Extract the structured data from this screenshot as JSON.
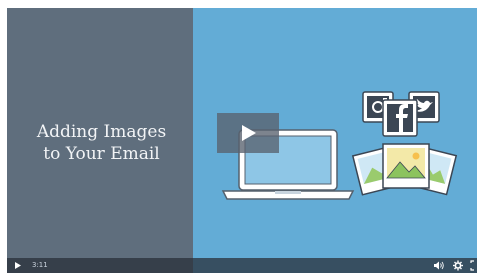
{
  "video": {
    "title_line1": "Adding Images",
    "title_line2": "to Your Email"
  },
  "controls": {
    "time": "3:11"
  },
  "icons": {
    "play": "play-icon",
    "play_small": "play-small-icon",
    "volume": "volume-icon",
    "settings": "gear-icon",
    "fullscreen": "fullscreen-icon",
    "laptop": "laptop-icon",
    "instagram": "instagram-icon",
    "facebook": "facebook-icon",
    "twitter": "twitter-icon",
    "photos": "photo-stack-icon"
  },
  "colors": {
    "left_panel": "#5f6e7d",
    "right_panel": "#63acd6",
    "control_bar": "#2f3844"
  }
}
